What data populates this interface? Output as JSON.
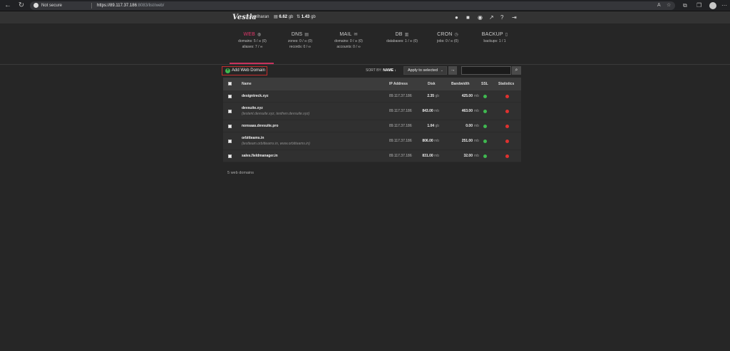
{
  "browser": {
    "security": "Not secure",
    "url_host": "https://89.117.37.186",
    "url_path": ":8083/list/web/"
  },
  "topbar": {
    "logo": "Vestia",
    "user": "hariharan",
    "disk_value": "6.62",
    "disk_unit": "gb",
    "bandwidth_value": "1.43",
    "bandwidth_unit": "gb"
  },
  "tabs": [
    {
      "label": "WEB",
      "icon": "globe-icon",
      "stat1": "domains: 5 / ∞ (0)",
      "stat2": "aliases: 7 / ∞"
    },
    {
      "label": "DNS",
      "icon": "server-icon",
      "stat1": "zones: 0 / ∞ (0)",
      "stat2": "records: 0 / ∞"
    },
    {
      "label": "MAIL",
      "icon": "mail-icon",
      "stat1": "domains: 0 / ∞ (0)",
      "stat2": "accounts: 0 / ∞"
    },
    {
      "label": "DB",
      "icon": "database-icon",
      "stat1": "databases: 1 / ∞ (0)",
      "stat2": ""
    },
    {
      "label": "CRON",
      "icon": "clock-icon",
      "stat1": "jobs: 0 / ∞ (0)",
      "stat2": ""
    },
    {
      "label": "BACKUP",
      "icon": "file-icon",
      "stat1": "backups: 1 / 1",
      "stat2": ""
    }
  ],
  "toolbar": {
    "add_label": "Add Web Domain",
    "sort_prefix": "SORT BY:",
    "sort_field": "NAME ↓",
    "apply_label": "Apply to selected",
    "search_placeholder": ""
  },
  "table": {
    "headers": {
      "name": "Name",
      "ip": "IP Address",
      "disk": "Disk",
      "bandwidth": "Bandwidth",
      "ssl": "SSL",
      "statistics": "Statistics"
    },
    "rows": [
      {
        "name": "designtreck.xyz",
        "aliases": "",
        "ip": "89.117.37.186",
        "disk": "2.35",
        "disk_unit": "gb",
        "bandwidth": "425.00",
        "bw_unit": "mb",
        "ssl": "on",
        "stats": "off"
      },
      {
        "name": "devsuite.xyz",
        "aliases": "(testent.devsuite.xyz, testhen.devsuite.xyz)",
        "ip": "89.117.37.186",
        "disk": "843.00",
        "disk_unit": "mb",
        "bandwidth": "463.00",
        "bw_unit": "mb",
        "ssl": "on",
        "stats": "off"
      },
      {
        "name": "nonsaas.devsuite.pro",
        "aliases": "",
        "ip": "89.117.37.186",
        "disk": "1.04",
        "disk_unit": "gb",
        "bandwidth": "0.00",
        "bw_unit": "mb",
        "ssl": "on",
        "stats": "off"
      },
      {
        "name": "orbitteams.in",
        "aliases": "(testteam.orbitteams.in, www.orbitteams.in)",
        "ip": "89.117.37.186",
        "disk": "806.00",
        "disk_unit": "mb",
        "bandwidth": "251.00",
        "bw_unit": "mb",
        "ssl": "on",
        "stats": "off"
      },
      {
        "name": "sales.fieldmanager.in",
        "aliases": "",
        "ip": "89.117.37.186",
        "disk": "831.00",
        "disk_unit": "mb",
        "bandwidth": "32.00",
        "bw_unit": "mb",
        "ssl": "on",
        "stats": "off"
      }
    ]
  },
  "footer": {
    "total": "5 web domains"
  },
  "colors": {
    "accent": "#e0376a",
    "on": "#3fb950",
    "off": "#e0312f",
    "highlight_border": "#c42d2d"
  }
}
